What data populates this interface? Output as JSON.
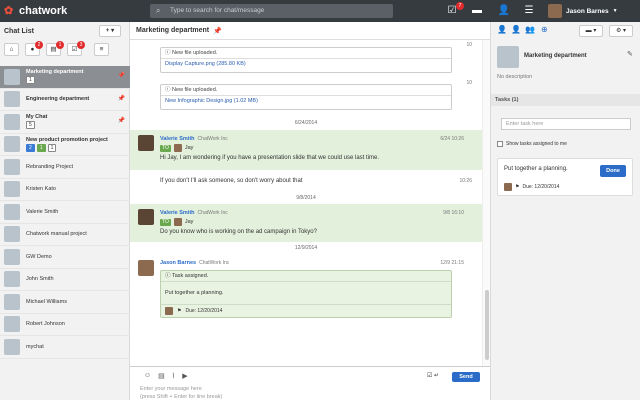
{
  "app": {
    "name": "chatwork"
  },
  "search": {
    "placeholder": "Type to search for chat/message"
  },
  "topbar": {
    "tasks_badge": "7",
    "user_name": "Jason Barnes"
  },
  "left": {
    "title": "Chat List",
    "add_label": "+ ▾",
    "filters": [
      {
        "badge": "2"
      },
      {
        "badge": "1"
      },
      {
        "badge": "3"
      }
    ],
    "rooms": [
      {
        "name": "Marketing department",
        "tags": [
          {
            "t": "1"
          }
        ],
        "selected": true,
        "pin": true
      },
      {
        "name": "Engineering department",
        "pin": true
      },
      {
        "name": "My Chat",
        "tags": [
          {
            "t": "5"
          }
        ],
        "pin": true
      },
      {
        "name": "New product promotion project",
        "tags": [
          {
            "t": "2",
            "c": "b"
          },
          {
            "t": "1",
            "c": "g"
          },
          {
            "t": "1"
          }
        ]
      },
      {
        "name": "Rebranding Project"
      },
      {
        "name": "Kristen Kato"
      },
      {
        "name": "Valerie Smith"
      },
      {
        "name": "Chatwork manual project"
      },
      {
        "name": "GW Demo"
      },
      {
        "name": "John Smith"
      },
      {
        "name": "Michael Williams"
      },
      {
        "name": "Robert Johnson"
      },
      {
        "name": "mychat"
      }
    ]
  },
  "center": {
    "title": "Marketing department",
    "messages": {
      "m1": {
        "header": "New file uploaded.",
        "file": "Display Capture.png (285.80 KB)",
        "time": "10"
      },
      "m2": {
        "header": "New file uploaded.",
        "file": "New Infographic Design.jpg (1.02 MB)",
        "time": "10"
      },
      "date1": "6/24/2014",
      "m3": {
        "sender": "Valerie Smith",
        "org": "ChatWork Inc",
        "to": "Jay",
        "text": "Hi Jay, I am wondering if you have a presentation slide that we could use last time.",
        "time": "6/24 10:26"
      },
      "m4": {
        "text": "If you don't I'll ask someone, so don't worry about that",
        "time": "10:26"
      },
      "date2": "9/8/2014",
      "m5": {
        "sender": "Valerie Smith",
        "org": "ChatWork Inc",
        "to": "Jay",
        "text": "Do you know who is working on the ad campaign in Tokyo?",
        "time": "9/8 16:10"
      },
      "date3": "12/9/2014",
      "m6": {
        "sender": "Jason Barnes",
        "org": "ChatWork Inc",
        "time": "12/9 21:15",
        "task_header": "Task assigned.",
        "task_text": "Put together a planning.",
        "due": "Due: 12/20/2014"
      }
    },
    "composer": {
      "placeholder_line1": "Enter your message here",
      "placeholder_line2": "(press Shift + Enter for line break)",
      "send": "Send"
    }
  },
  "right": {
    "room_title": "Marketing department",
    "description": "No description",
    "tasks_header": "Tasks (1)",
    "task_input_placeholder": "Enter task here",
    "show_assigned": "Show tasks assigned to me",
    "task": {
      "text": "Put together a planning.",
      "done": "Done",
      "due": "Due: 12/20/2014"
    }
  }
}
